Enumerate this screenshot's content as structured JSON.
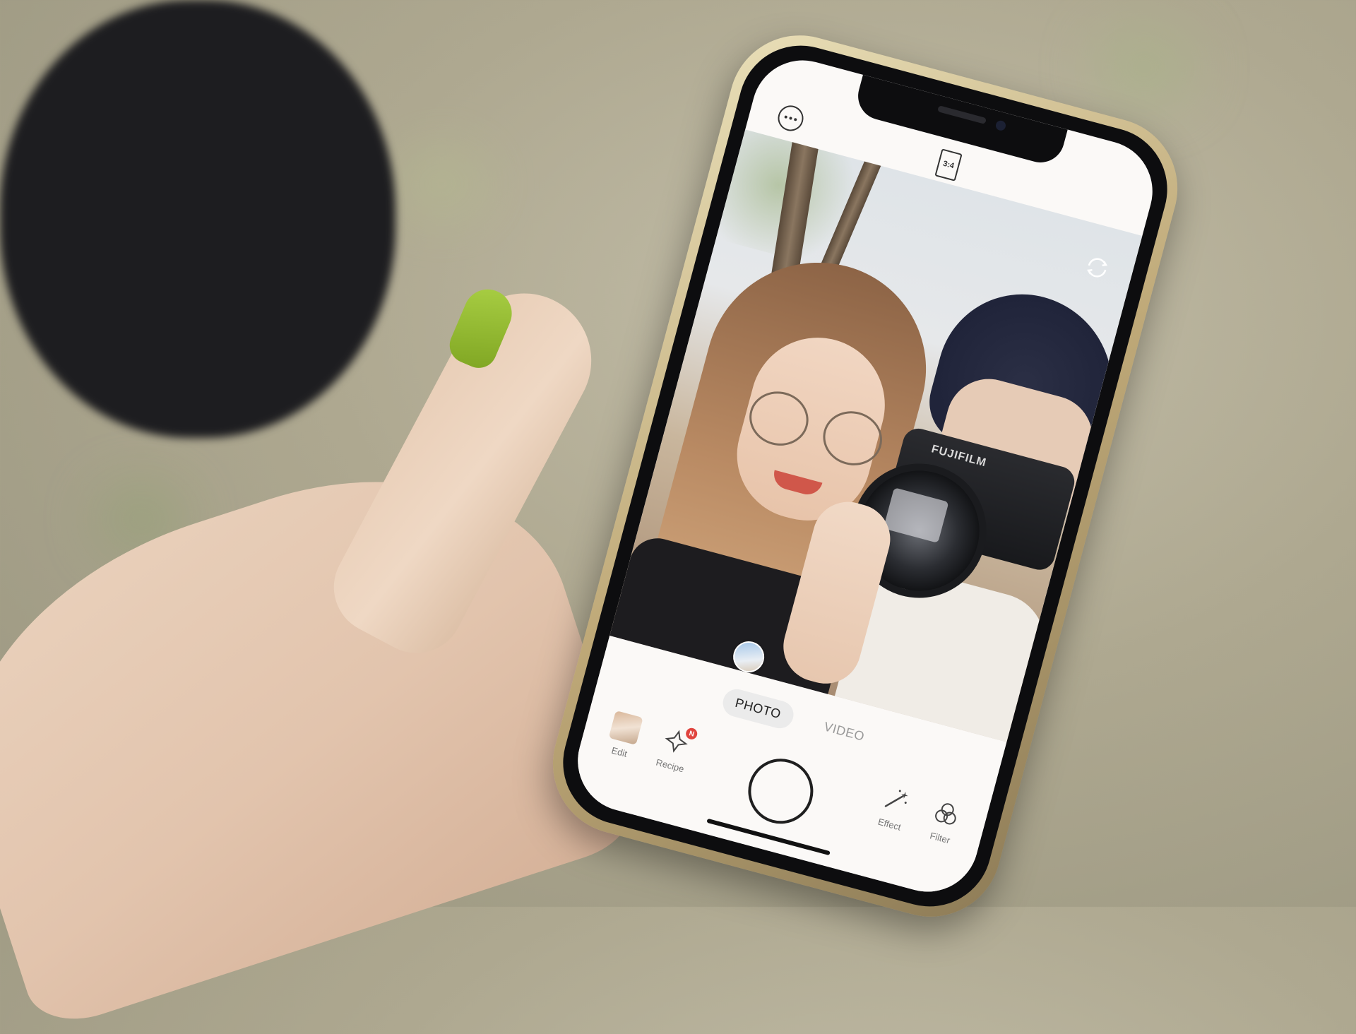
{
  "app": {
    "top_bar": {
      "more_icon": "more-horizontal-icon",
      "ratio_label": "3:4",
      "switch_camera_icon": "camera-rotate-icon"
    },
    "viewfinder": {
      "camera_brand": "FUJIFILM",
      "last_shot_icon": "thumbnail-avatar"
    },
    "modes": [
      {
        "label": "PHOTO",
        "active": true
      },
      {
        "label": "VIDEO",
        "active": false
      }
    ],
    "tools": {
      "edit": {
        "label": "Edit",
        "icon": "photo-thumbnail"
      },
      "recipe": {
        "label": "Recipe",
        "icon": "sparkle-icon",
        "badge": "N"
      },
      "effect": {
        "label": "Effect",
        "icon": "magic-wand-icon"
      },
      "filter": {
        "label": "Filter",
        "icon": "filter-circles-icon"
      }
    },
    "colors": {
      "nail": "#8fb82e",
      "badge": "#e0443e",
      "ui_background": "#fbf9f7"
    }
  }
}
